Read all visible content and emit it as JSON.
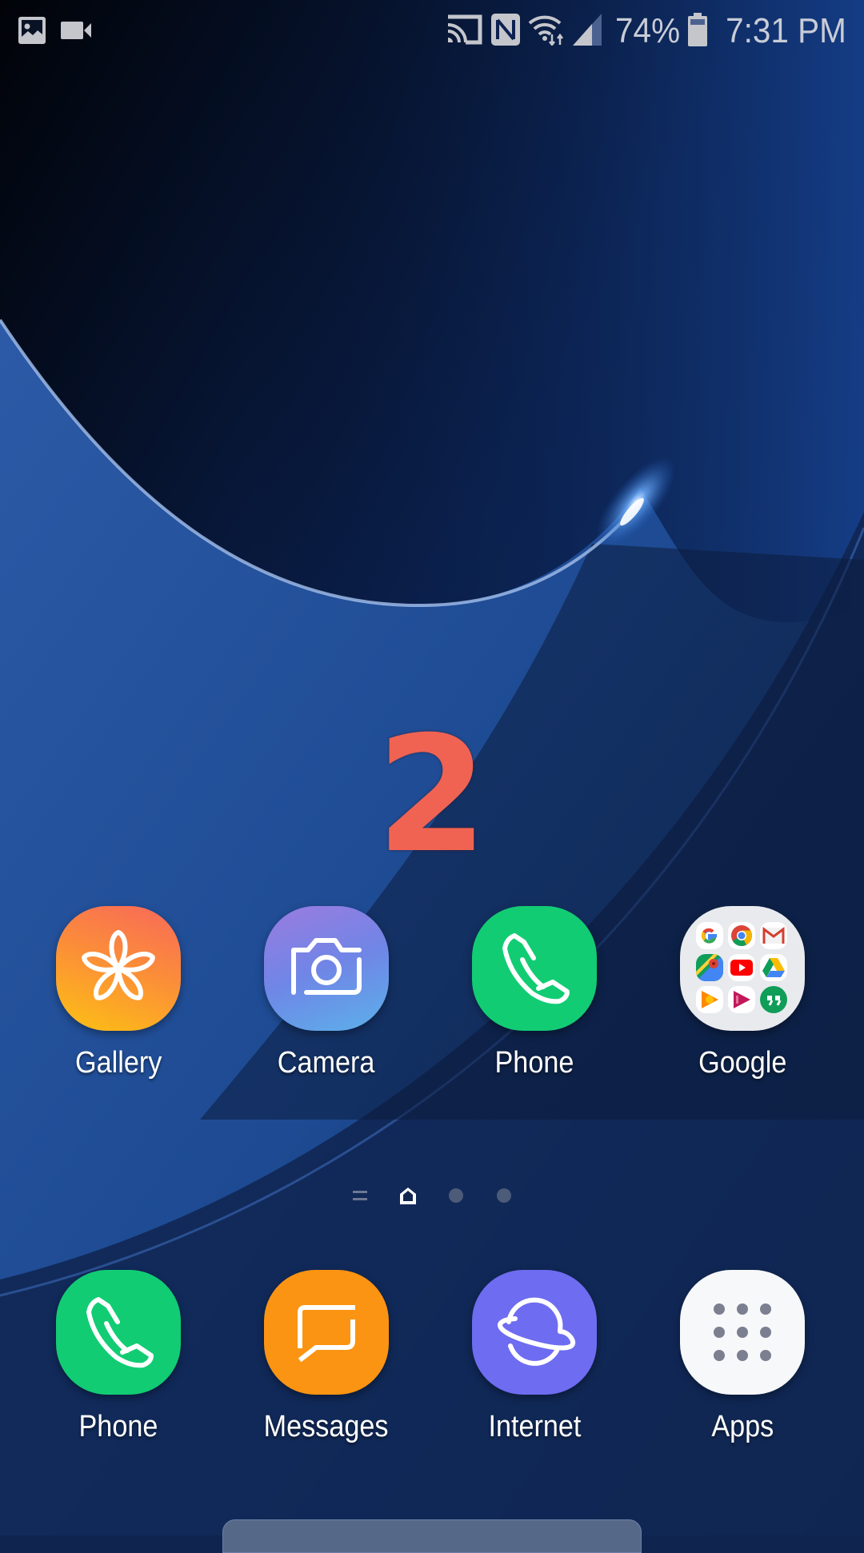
{
  "status_bar": {
    "left_icons": [
      "gallery-notification-icon",
      "video-recording-icon"
    ],
    "right_icons": [
      "screen-mirroring-icon",
      "nfc-icon",
      "wifi-data-icon",
      "signal-strength-icon",
      "battery-icon"
    ],
    "battery_percent_label": "74%",
    "battery_level": 0.74,
    "time": "7:31 PM"
  },
  "annotation": {
    "label": "2",
    "color": "#f06352"
  },
  "home_screen": {
    "apps": [
      {
        "label": "Gallery",
        "icon": "gallery-flower-icon",
        "color": "#fb8c3a"
      },
      {
        "label": "Camera",
        "icon": "camera-icon",
        "color": "#6f86e6"
      },
      {
        "label": "Phone",
        "icon": "phone-handset-icon",
        "color": "#12cc74"
      },
      {
        "label": "Google",
        "icon": "google-folder-icon",
        "color": "#e8eaee",
        "folder_apps": [
          "Google",
          "Chrome",
          "Gmail",
          "Maps",
          "YouTube",
          "Drive",
          "Play Music",
          "Play Movies",
          "Hangouts"
        ]
      }
    ]
  },
  "page_indicator": {
    "items": [
      "menu-lines-icon",
      "home-page-icon",
      "page-dot-icon",
      "page-dot-icon"
    ],
    "active_index": 1,
    "page_count": 4
  },
  "dock": {
    "apps": [
      {
        "label": "Phone",
        "icon": "phone-handset-icon",
        "color": "#12cc74"
      },
      {
        "label": "Messages",
        "icon": "message-bubble-icon",
        "color": "#fb9412"
      },
      {
        "label": "Internet",
        "icon": "planet-browser-icon",
        "color": "#6e6cf0"
      },
      {
        "label": "Apps",
        "icon": "app-grid-icon",
        "color": "#f7f8fa"
      }
    ]
  }
}
